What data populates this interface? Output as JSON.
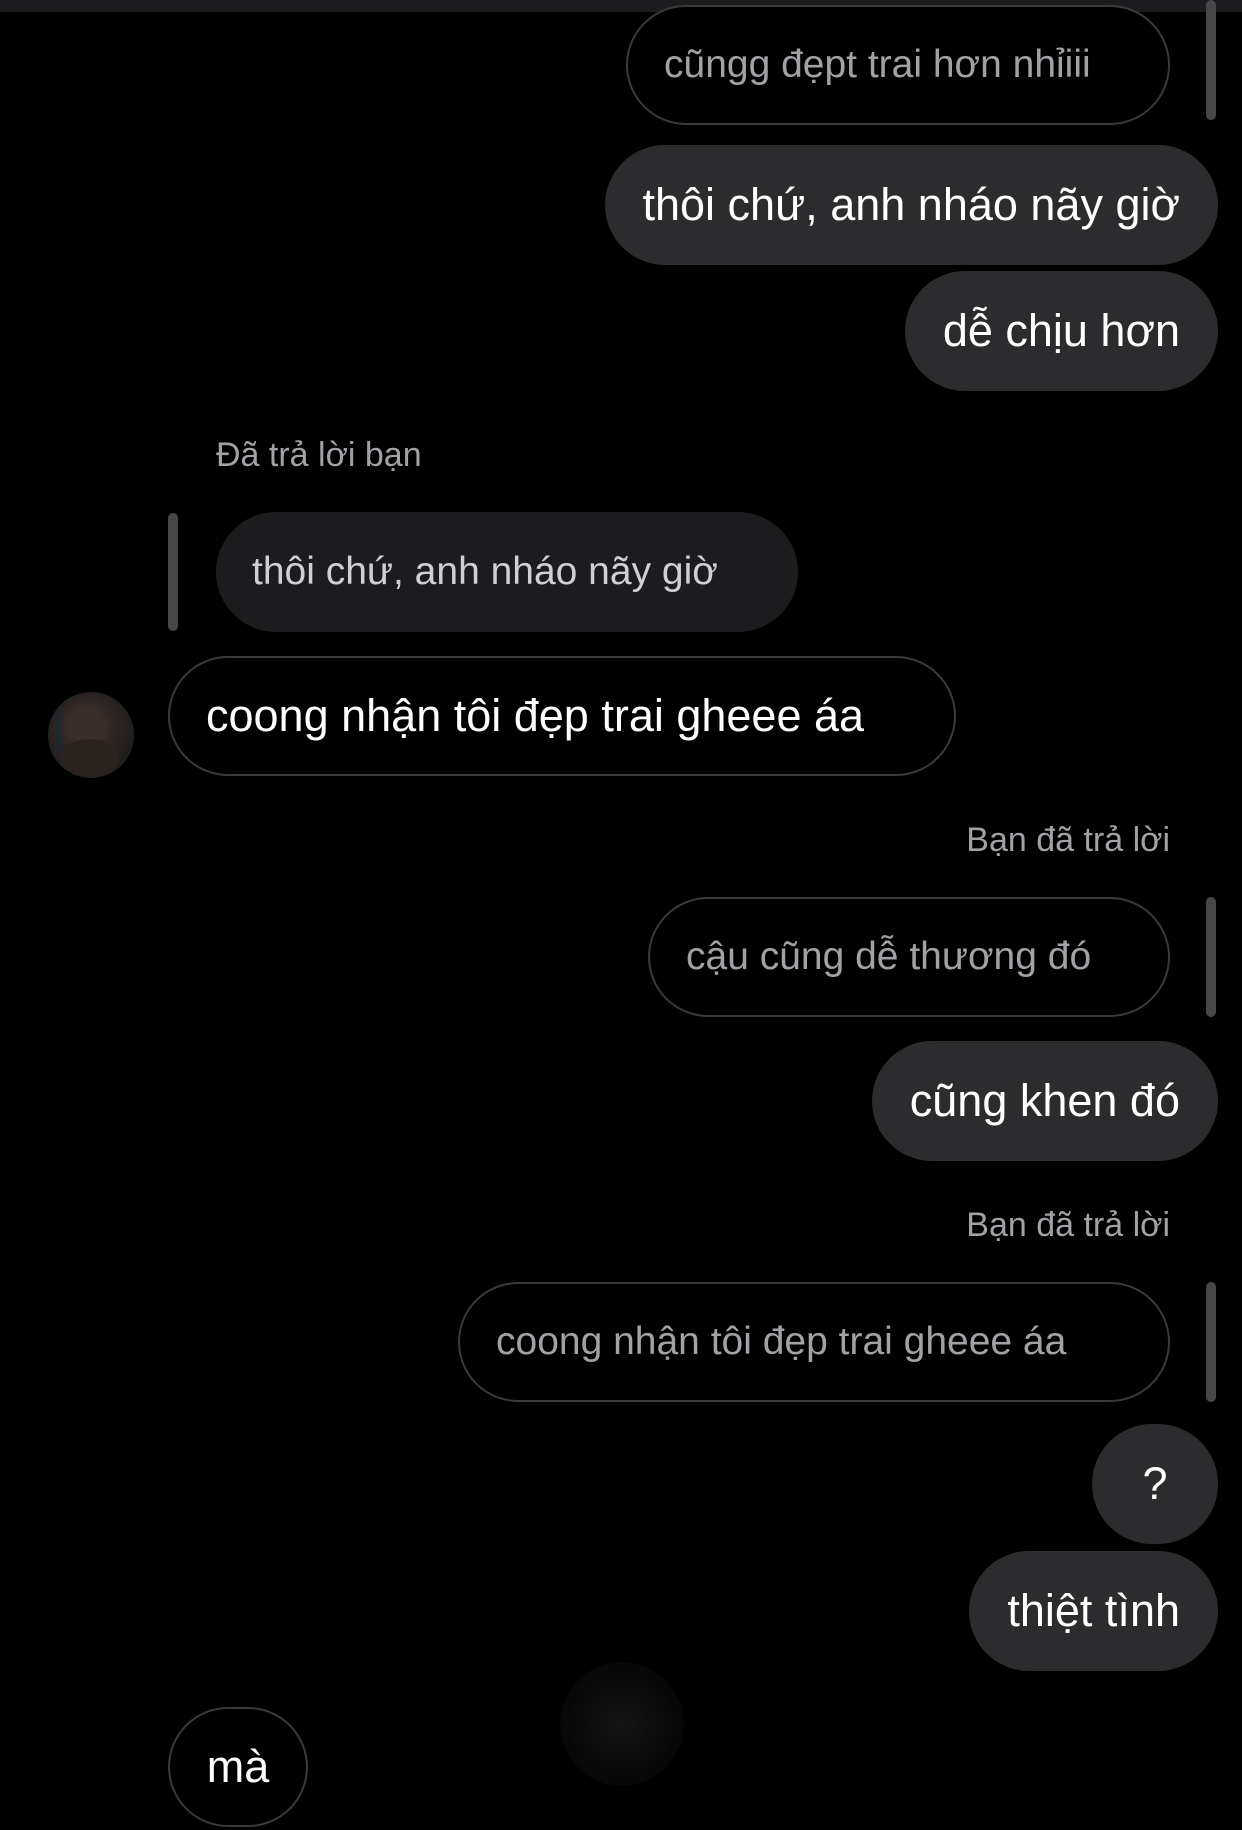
{
  "messages": {
    "m1": "cũngg đẹpt trai hơn nhỉiii",
    "m2": "thôi chứ, anh nháo nãy giờ",
    "m3": "dễ chịu hơn",
    "m4_label": "Đã trả lời bạn",
    "m4_quote": "thôi chứ, anh nháo nãy giờ",
    "m5": "coong nhận tôi đẹp trai gheee áa",
    "m6_label": "Bạn đã trả lời",
    "m6_quote": "cậu cũng dễ thương đó",
    "m7": "cũng khen đó",
    "m8_label": "Bạn đã trả lời",
    "m8_quote": "coong nhận tôi đẹp trai gheee áa",
    "m9": "?",
    "m10": "thiệt tình",
    "m11": "mà"
  },
  "colors": {
    "background": "#000000",
    "sent_bubble": "#2c2c2e",
    "received_border": "#3a3a3c",
    "meta_text": "#a1a1a6"
  }
}
